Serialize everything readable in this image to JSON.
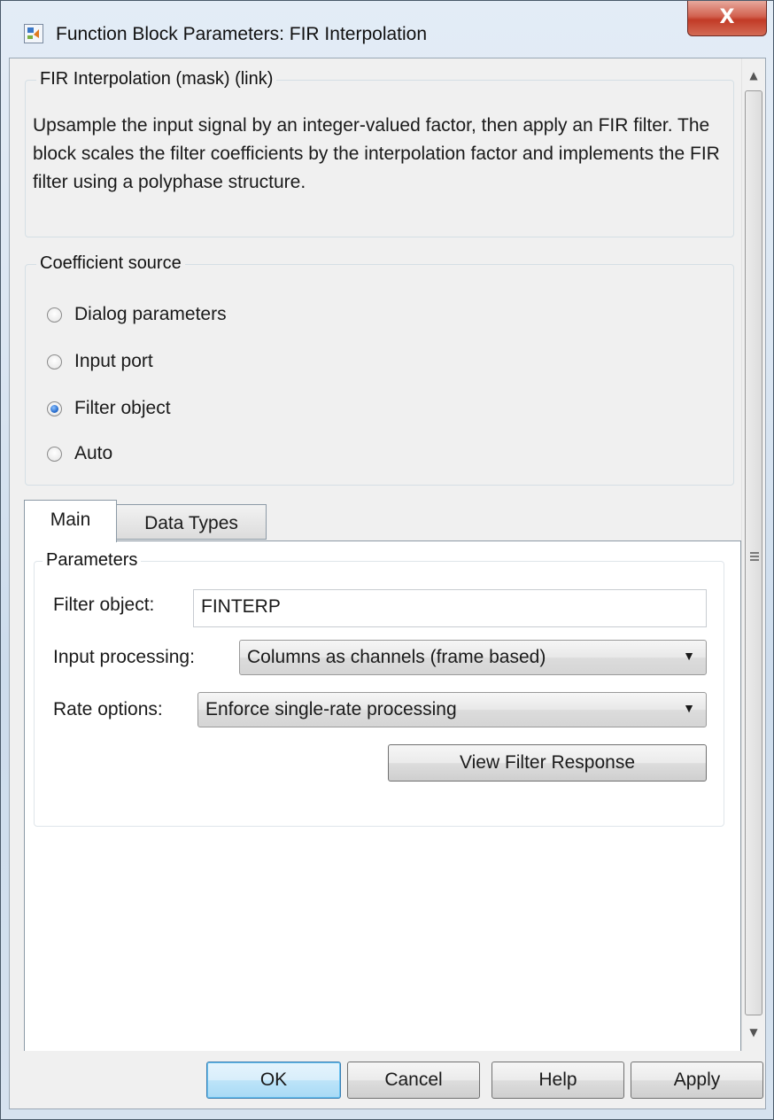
{
  "window": {
    "title": "Function Block Parameters: FIR Interpolation",
    "close_glyph": "X"
  },
  "description_group": {
    "legend": "FIR Interpolation (mask) (link)",
    "text": "Upsample the input signal by an integer-valued factor, then apply an FIR filter. The block scales the filter coefficients by the interpolation factor and implements the FIR filter using a polyphase structure."
  },
  "coefficient_source": {
    "legend": "Coefficient source",
    "options": [
      {
        "label": "Dialog parameters",
        "checked": false
      },
      {
        "label": "Input port",
        "checked": false
      },
      {
        "label": "Filter object",
        "checked": true
      },
      {
        "label": "Auto",
        "checked": false
      }
    ]
  },
  "tabs": [
    {
      "label": "Main",
      "active": true
    },
    {
      "label": "Data Types",
      "active": false
    }
  ],
  "parameters": {
    "legend": "Parameters",
    "filter_object_label": "Filter object:",
    "filter_object_value": "FINTERP",
    "input_processing_label": "Input processing:",
    "input_processing_value": "Columns as channels (frame based)",
    "rate_options_label": "Rate options:",
    "rate_options_value": "Enforce single-rate processing",
    "view_filter_response_label": "View Filter Response"
  },
  "buttons": {
    "ok": "OK",
    "cancel": "Cancel",
    "help": "Help",
    "apply": "Apply"
  },
  "icons": {
    "window_icon": "simulink-block-icon",
    "close": "close-icon",
    "scroll_up": "scroll-up-arrow-icon",
    "scroll_down": "scroll-down-arrow-icon",
    "dropdown": "chevron-down-icon"
  }
}
